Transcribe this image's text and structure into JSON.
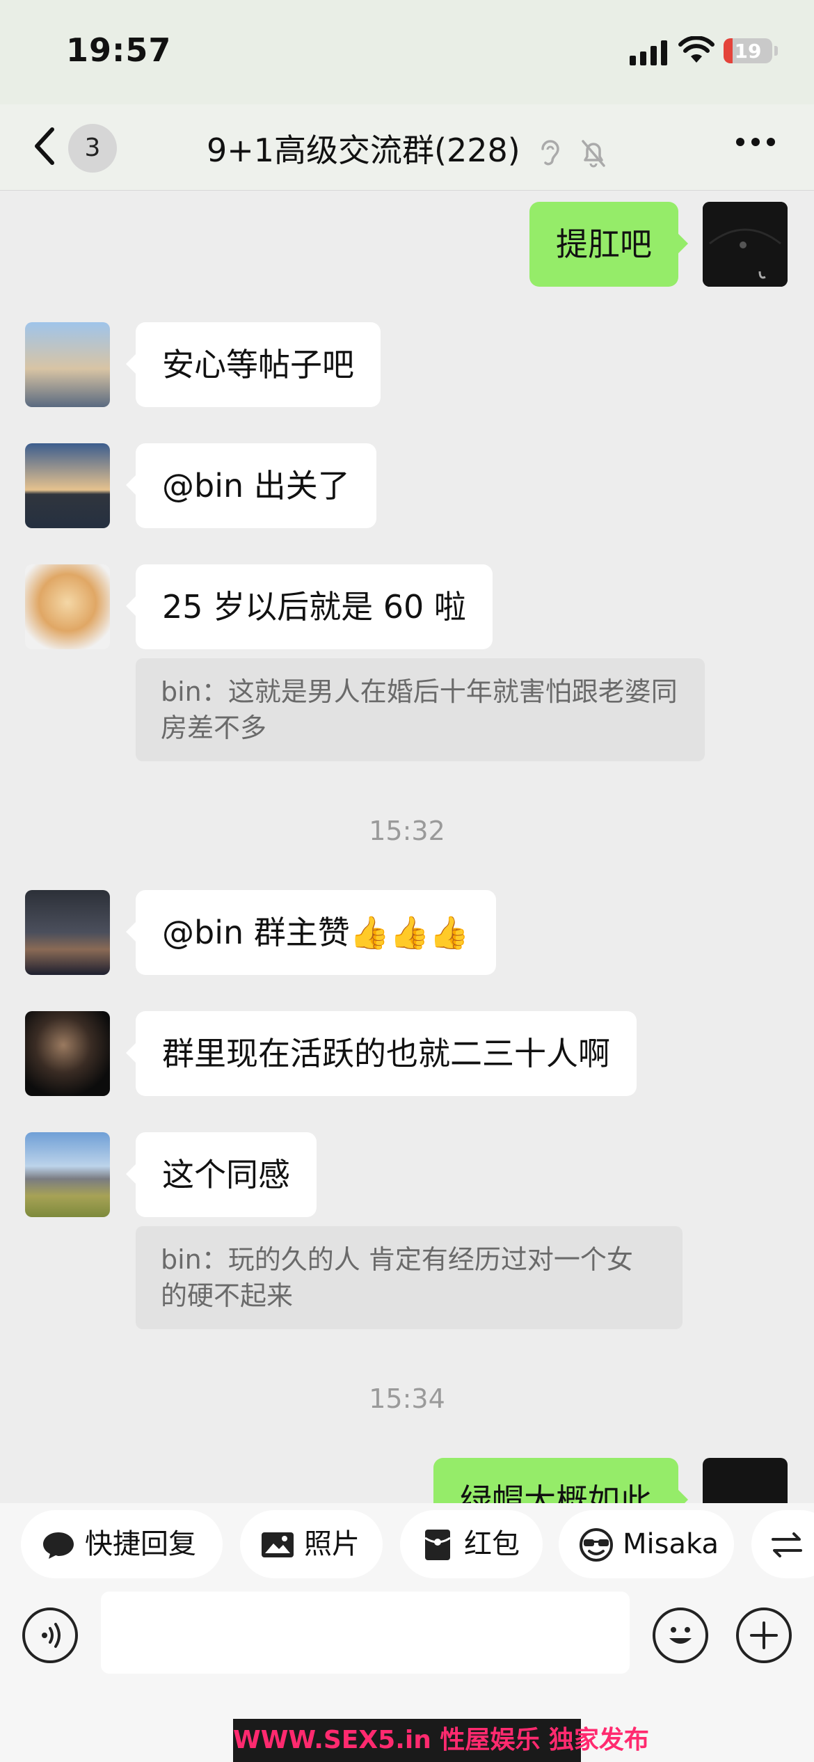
{
  "status_bar": {
    "time": "19:57",
    "battery": "19",
    "battery_level": 0.19
  },
  "header": {
    "unread_count": "3",
    "title": "9+1高级交流群(228)"
  },
  "messages": {
    "m1": {
      "text": "提肛吧",
      "side": "right"
    },
    "m2": {
      "text": "安心等帖子吧"
    },
    "m3": {
      "text": "@bin 出关了"
    },
    "m4": {
      "text": "25 岁以后就是 60 啦"
    },
    "q1": {
      "text": "bin：这就是男人在婚后十年就害怕跟老婆同房差不多"
    },
    "t1": "15:32",
    "m5": {
      "text": "@bin 群主赞👍👍👍"
    },
    "m6": {
      "text": "群里现在活跃的也就二三十人啊"
    },
    "m7": {
      "text": "这个同感"
    },
    "q2": {
      "text": "bin：玩的久的人 肯定有经历过对一个女的硬不起来"
    },
    "t2": "15:34",
    "m8": {
      "text": "绿帽大概如此",
      "side": "right"
    }
  },
  "quick_bar": {
    "quick_reply": "快捷回复",
    "photo": "照片",
    "red_packet": "红包",
    "misaka": "Misaka"
  },
  "icons": {
    "back": "chevron-left-icon",
    "ear": "ear-icon",
    "mute": "bell-slash-icon",
    "more": "more-icon",
    "voice": "voice-icon",
    "emoji": "emoji-icon",
    "plus": "plus-icon",
    "swap": "swap-icon"
  },
  "colors": {
    "self_bubble": "#95ec69",
    "other_bubble": "#ffffff",
    "background": "#ededed",
    "watermark_text": "#ff2a6f"
  },
  "watermark": "WWW.SEX5.in 性屋娱乐 独家发布"
}
